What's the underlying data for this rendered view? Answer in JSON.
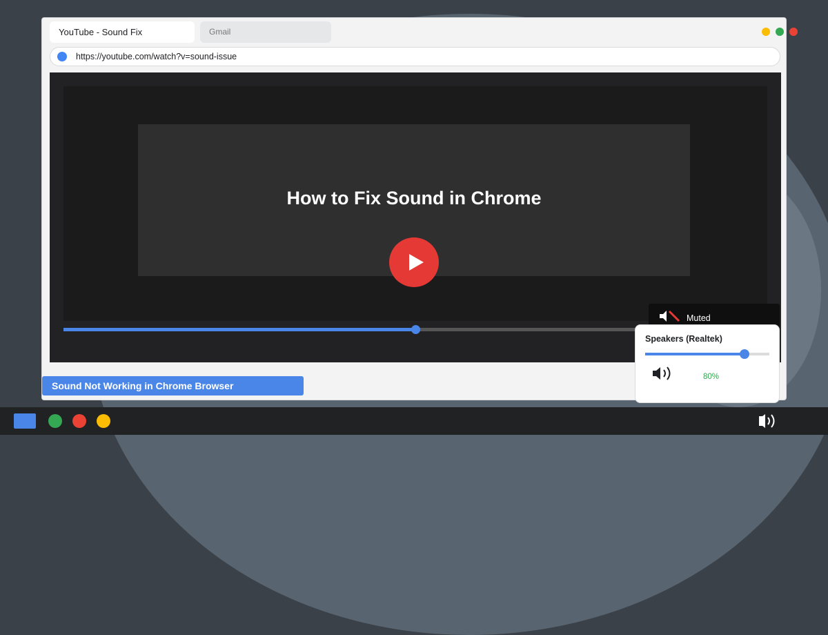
{
  "browser": {
    "tabs": [
      {
        "label": "YouTube - Sound Fix",
        "active": true
      },
      {
        "label": "Gmail",
        "active": false
      }
    ],
    "address": "https://youtube.com/watch?v=sound-issue",
    "window_dot_colors": [
      "#fbbc04",
      "#34a853",
      "#ea4335"
    ]
  },
  "video": {
    "title": "How to Fix Sound in Chrome",
    "progress": 0.6072,
    "muted_label": "Muted"
  },
  "caption": "Sound Not Working in Chrome Browser",
  "volume_panel": {
    "device": "Speakers (Realtek)",
    "level": 0.8,
    "percent_label": "80%"
  },
  "taskbar": {
    "icons": [
      "app-square-icon",
      "green-dot-icon",
      "red-dot-icon",
      "yellow-dot-icon",
      "speaker-icon"
    ]
  },
  "colors": {
    "accent": "#4a86e8",
    "play": "#e53935",
    "green": "#34a853",
    "red": "#ea4335",
    "yellow": "#fbbc04"
  }
}
